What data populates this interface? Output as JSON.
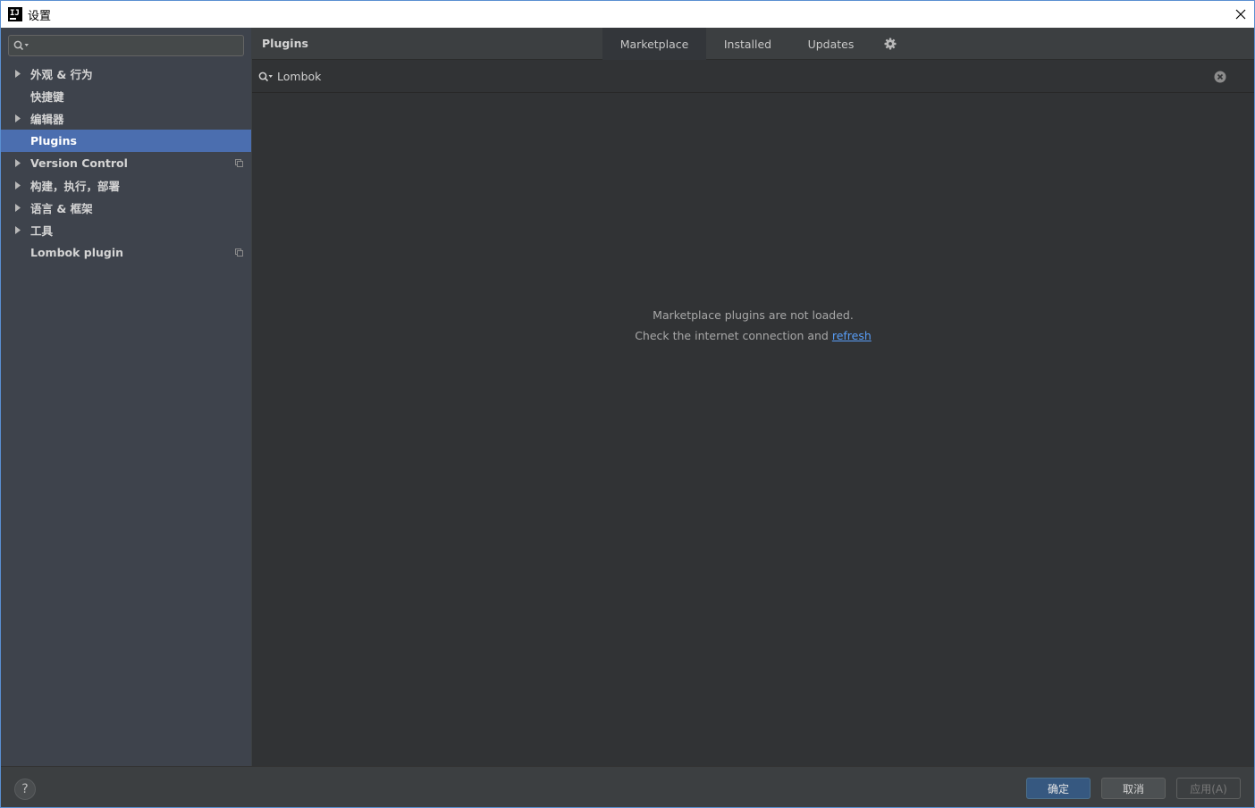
{
  "window": {
    "title": "设置",
    "app_icon": "intellij-icon"
  },
  "sidebar": {
    "search_placeholder": "",
    "items": [
      {
        "label": "外观 & 行为",
        "expandable": true
      },
      {
        "label": "快捷键",
        "expandable": false
      },
      {
        "label": "编辑器",
        "expandable": true
      },
      {
        "label": "Plugins",
        "expandable": false,
        "selected": true
      },
      {
        "label": "Version Control",
        "expandable": true,
        "project_icon": true
      },
      {
        "label": "构建，执行，部署",
        "expandable": true
      },
      {
        "label": "语言 & 框架",
        "expandable": true
      },
      {
        "label": "工具",
        "expandable": true
      },
      {
        "label": "Lombok plugin",
        "expandable": false,
        "project_icon": true
      }
    ]
  },
  "plugins": {
    "title": "Plugins",
    "tabs": [
      {
        "label": "Marketplace",
        "active": true
      },
      {
        "label": "Installed",
        "active": false
      },
      {
        "label": "Updates",
        "active": false
      }
    ],
    "search_value": "Lombok",
    "message_line1": "Marketplace plugins are not loaded.",
    "message_line2_prefix": "Check the internet connection and ",
    "message_link": "refresh"
  },
  "footer": {
    "help_label": "?",
    "ok_label": "确定",
    "cancel_label": "取消",
    "apply_label": "应用(A)"
  },
  "colors": {
    "selected_bg": "#4b6eaf",
    "link": "#589df6",
    "ok_button": "#365880"
  }
}
